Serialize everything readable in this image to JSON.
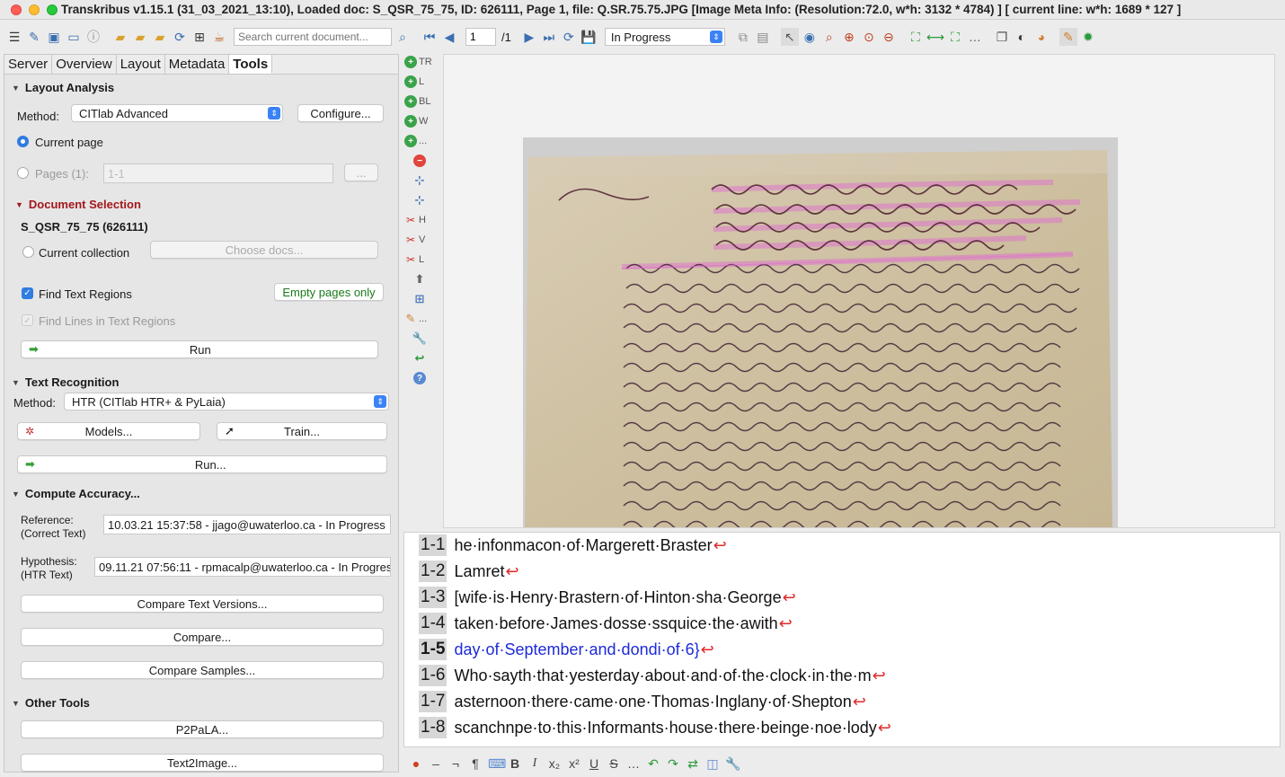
{
  "window": {
    "title": "Transkribus v1.15.1 (31_03_2021_13:10), Loaded doc: S_QSR_75_75, ID: 626111, Page 1, file: Q.SR.75.75.JPG [Image Meta Info: (Resolution:72.0, w*h: 3132 * 4784) ] [ current line: w*h: 1689 * 127 ]"
  },
  "toolbar": {
    "search_placeholder": "Search current document...",
    "page_value": "1",
    "page_total": "/1",
    "status_value": "In Progress"
  },
  "tabs": [
    "Server",
    "Overview",
    "Layout",
    "Metadata",
    "Tools"
  ],
  "layout_analysis": {
    "title": "Layout Analysis",
    "method_label": "Method:",
    "method_value": "CITlab Advanced",
    "configure": "Configure...",
    "current_page": "Current page",
    "pages_label": "Pages (1):",
    "pages_value": "1-1",
    "pages_btn": "..."
  },
  "document_selection": {
    "title": "Document Selection",
    "doc_name": "S_QSR_75_75 (626111)",
    "current_collection": "Current collection",
    "choose_docs": "Choose docs...",
    "find_text_regions": "Find Text Regions",
    "empty_pages_only": "Empty pages only",
    "find_lines": "Find Lines in Text Regions",
    "run": "Run"
  },
  "text_recognition": {
    "title": "Text Recognition",
    "method_label": "Method:",
    "method_value": "HTR (CITlab HTR+ & PyLaia)",
    "models": "Models...",
    "train": "Train...",
    "run": "Run..."
  },
  "compute_accuracy": {
    "title": "Compute Accuracy...",
    "reference_label": "Reference:",
    "reference_sub": "(Correct Text)",
    "reference_value": "10.03.21 15:37:58 - jjago@uwaterloo.ca - In Progress",
    "hypothesis_label": "Hypothesis:",
    "hypothesis_sub": "(HTR Text)",
    "hypothesis_value": "09.11.21 07:56:11 - rpmacalp@uwaterloo.ca - In Progress",
    "compare_text_versions": "Compare Text Versions...",
    "compare": "Compare...",
    "compare_samples": "Compare Samples..."
  },
  "other_tools": {
    "title": "Other Tools",
    "p2pala": "P2PaLA...",
    "text2image": "Text2Image..."
  },
  "vertical_tools": [
    {
      "icon": "add-region-icon",
      "label": "TR"
    },
    {
      "icon": "add-line-icon",
      "label": "L"
    },
    {
      "icon": "add-baseline-icon",
      "label": "BL"
    },
    {
      "icon": "add-word-icon",
      "label": "W"
    },
    {
      "icon": "add-more-icon",
      "label": "..."
    },
    {
      "icon": "remove-shape-icon",
      "label": ""
    },
    {
      "icon": "add-point-icon",
      "label": ""
    },
    {
      "icon": "remove-point-icon",
      "label": ""
    },
    {
      "icon": "split-horizontal-icon",
      "label": "H"
    },
    {
      "icon": "split-vertical-icon",
      "label": "V"
    },
    {
      "icon": "split-line-icon",
      "label": "L"
    },
    {
      "icon": "merge-icon",
      "label": ""
    },
    {
      "icon": "table-icon",
      "label": ""
    },
    {
      "icon": "edit-more-icon",
      "label": "..."
    },
    {
      "icon": "wrench-icon",
      "label": ""
    },
    {
      "icon": "undo-icon",
      "label": ""
    },
    {
      "icon": "help-icon",
      "label": ""
    }
  ],
  "transcription": {
    "current_line": "1-5",
    "lines": [
      {
        "num": "1-1",
        "text": "he·infonmacon·of·Margerett·Braster"
      },
      {
        "num": "1-2",
        "text": "Lamret"
      },
      {
        "num": "1-3",
        "text": "[wife·is·Henry·Brastern·of·Hinton·sha·George"
      },
      {
        "num": "1-4",
        "text": "taken·before·James·dosse·ssquice·the·awith"
      },
      {
        "num": "1-5",
        "text": "day·of·September·and·dondi·of·6}"
      },
      {
        "num": "1-6",
        "text": "Who·sayth·that·yesterday·about·and·of·the·clock·in·the·m"
      },
      {
        "num": "1-7",
        "text": "asternoon·there·came·one·Thomas·Inglany·of·Shepton"
      },
      {
        "num": "1-8",
        "text": "scanchnpe·to·this·Informants·house·there·beinge·noe·lody"
      }
    ]
  },
  "colors": {
    "accent_blue": "#2f7de1",
    "current_line_text": "#1d2bd8",
    "section_red": "#a3171b",
    "return_marker": "#e02a2a"
  }
}
